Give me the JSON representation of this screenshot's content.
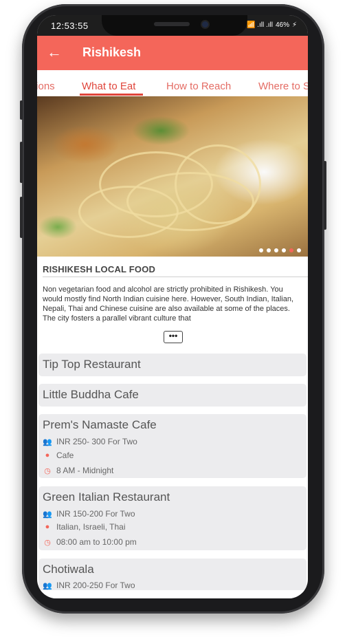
{
  "status": {
    "time": "12:53:55",
    "signal": "📶 .ıll .ıll",
    "battery": "46%"
  },
  "appbar": {
    "title": "Rishikesh",
    "back_icon": "arrow-left-icon"
  },
  "tabs": [
    {
      "label": "tions"
    },
    {
      "label": "What to Eat"
    },
    {
      "label": "How to Reach"
    },
    {
      "label": "Where to S"
    }
  ],
  "carousel": {
    "active_index": 4,
    "count": 6
  },
  "section": {
    "title": "RISHIKESH LOCAL FOOD",
    "description": "Non vegetarian food and alcohol are strictly prohibited in Rishikesh. You would mostly find North Indian cuisine here. However, South Indian, Italian, Nepali, Thai and Chinese cuisine are also available at some of the places. The city fosters a parallel vibrant culture that",
    "more_label": "•••"
  },
  "restaurants": [
    {
      "name": "Tip Top Restaurant"
    },
    {
      "name": "Little Buddha Cafe"
    },
    {
      "name": "Prem's Namaste Cafe",
      "price": "INR 250- 300 For Two",
      "cuisine": "Cafe",
      "hours": "8 AM - Midnight"
    },
    {
      "name": "Green Italian Restaurant",
      "price": "INR 150-200 For Two",
      "cuisine": "Italian, Israeli, Thai",
      "hours": "08:00 am to 10:00 pm"
    },
    {
      "name": "Chotiwala",
      "price": "INR 200-250 For Two"
    }
  ],
  "colors": {
    "accent": "#f4665a",
    "card": "#ececee"
  }
}
